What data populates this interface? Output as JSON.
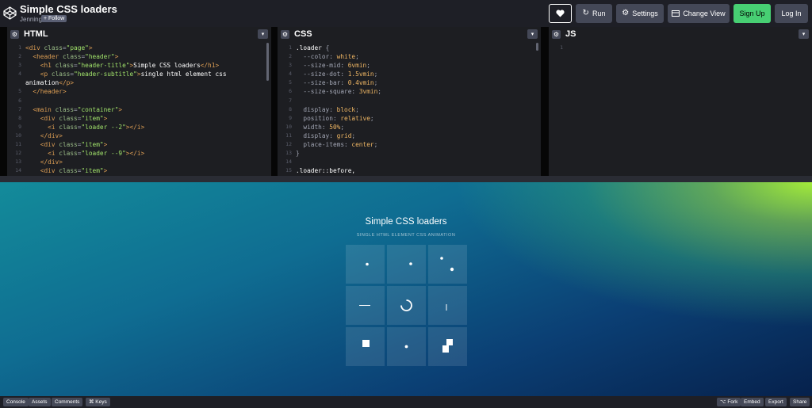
{
  "header": {
    "title": "Simple CSS loaders",
    "author": "Jenning",
    "follow_label": "+ Follow",
    "heart_icon": "heart-icon",
    "buttons": {
      "run": "Run",
      "settings": "Settings",
      "change_view": "Change View",
      "sign_up": "Sign Up",
      "log_in": "Log In"
    },
    "accent_color": "#47cf73"
  },
  "editors": {
    "html": {
      "label": "HTML",
      "line_numbers": [
        "1",
        "2",
        "3",
        "4",
        "",
        "5",
        "6",
        "7",
        "8",
        "9",
        "10",
        "11",
        "12",
        "13",
        "14"
      ],
      "lines": [
        [
          [
            "t",
            "<div "
          ],
          [
            "a",
            "class"
          ],
          [
            "p",
            "="
          ],
          [
            "s",
            "\"page\""
          ],
          [
            "t",
            ">"
          ]
        ],
        [
          [
            "h",
            "  "
          ],
          [
            "t",
            "<header "
          ],
          [
            "a",
            "class"
          ],
          [
            "p",
            "="
          ],
          [
            "s",
            "\"header\""
          ],
          [
            "t",
            ">"
          ]
        ],
        [
          [
            "h",
            "    "
          ],
          [
            "t",
            "<h1 "
          ],
          [
            "a",
            "class"
          ],
          [
            "p",
            "="
          ],
          [
            "s",
            "\"header-title\""
          ],
          [
            "t",
            ">"
          ],
          [
            "h",
            "Simple CSS loaders"
          ],
          [
            "t",
            "</h1>"
          ]
        ],
        [
          [
            "h",
            "    "
          ],
          [
            "t",
            "<p "
          ],
          [
            "a",
            "class"
          ],
          [
            "p",
            "="
          ],
          [
            "s",
            "\"header-subtitle\""
          ],
          [
            "t",
            ">"
          ],
          [
            "h",
            "single html element css"
          ]
        ],
        [
          [
            "h",
            "animation"
          ],
          [
            "t",
            "</p>"
          ]
        ],
        [
          [
            "h",
            "  "
          ],
          [
            "t",
            "</header>"
          ]
        ],
        [
          [
            "h",
            ""
          ]
        ],
        [
          [
            "h",
            "  "
          ],
          [
            "t",
            "<main "
          ],
          [
            "a",
            "class"
          ],
          [
            "p",
            "="
          ],
          [
            "s",
            "\"container\""
          ],
          [
            "t",
            ">"
          ]
        ],
        [
          [
            "h",
            "    "
          ],
          [
            "t",
            "<div "
          ],
          [
            "a",
            "class"
          ],
          [
            "p",
            "="
          ],
          [
            "s",
            "\"item\""
          ],
          [
            "t",
            ">"
          ]
        ],
        [
          [
            "h",
            "      "
          ],
          [
            "t",
            "<i "
          ],
          [
            "a",
            "class"
          ],
          [
            "p",
            "="
          ],
          [
            "s",
            "\"loader --2\""
          ],
          [
            "t",
            ">"
          ],
          [
            "t",
            "</i>"
          ]
        ],
        [
          [
            "h",
            "    "
          ],
          [
            "t",
            "</div>"
          ]
        ],
        [
          [
            "h",
            "    "
          ],
          [
            "t",
            "<div "
          ],
          [
            "a",
            "class"
          ],
          [
            "p",
            "="
          ],
          [
            "s",
            "\"item\""
          ],
          [
            "t",
            ">"
          ]
        ],
        [
          [
            "h",
            "      "
          ],
          [
            "t",
            "<i "
          ],
          [
            "a",
            "class"
          ],
          [
            "p",
            "="
          ],
          [
            "s",
            "\"loader --9\""
          ],
          [
            "t",
            ">"
          ],
          [
            "t",
            "</i>"
          ]
        ],
        [
          [
            "h",
            "    "
          ],
          [
            "t",
            "</div>"
          ]
        ],
        [
          [
            "h",
            "    "
          ],
          [
            "t",
            "<div "
          ],
          [
            "a",
            "class"
          ],
          [
            "p",
            "="
          ],
          [
            "s",
            "\"item\""
          ],
          [
            "t",
            ">"
          ]
        ]
      ]
    },
    "css": {
      "label": "CSS",
      "line_numbers": [
        "1",
        "2",
        "3",
        "4",
        "5",
        "6",
        "7",
        "8",
        "9",
        "10",
        "11",
        "12",
        "13",
        "14",
        "15"
      ],
      "lines": [
        [
          [
            "h",
            ".loader "
          ],
          [
            "p",
            "{"
          ]
        ],
        [
          [
            "h",
            "  "
          ],
          [
            "p",
            "--color: "
          ],
          [
            "v",
            "white"
          ],
          [
            "p",
            ";"
          ]
        ],
        [
          [
            "h",
            "  "
          ],
          [
            "p",
            "--size-mid: "
          ],
          [
            "v",
            "6vmin"
          ],
          [
            "p",
            ";"
          ]
        ],
        [
          [
            "h",
            "  "
          ],
          [
            "p",
            "--size-dot: "
          ],
          [
            "v",
            "1.5vmin"
          ],
          [
            "p",
            ";"
          ]
        ],
        [
          [
            "h",
            "  "
          ],
          [
            "p",
            "--size-bar: "
          ],
          [
            "v",
            "0.4vmin"
          ],
          [
            "p",
            ";"
          ]
        ],
        [
          [
            "h",
            "  "
          ],
          [
            "p",
            "--size-square: "
          ],
          [
            "v",
            "3vmin"
          ],
          [
            "p",
            ";"
          ]
        ],
        [
          [
            "h",
            ""
          ]
        ],
        [
          [
            "h",
            "  "
          ],
          [
            "p",
            "display: "
          ],
          [
            "v",
            "block"
          ],
          [
            "p",
            ";"
          ]
        ],
        [
          [
            "h",
            "  "
          ],
          [
            "p",
            "position: "
          ],
          [
            "v",
            "relative"
          ],
          [
            "p",
            ";"
          ]
        ],
        [
          [
            "h",
            "  "
          ],
          [
            "p",
            "width: "
          ],
          [
            "v",
            "50%"
          ],
          [
            "p",
            ";"
          ]
        ],
        [
          [
            "h",
            "  "
          ],
          [
            "p",
            "display: "
          ],
          [
            "v",
            "grid"
          ],
          [
            "p",
            ";"
          ]
        ],
        [
          [
            "h",
            "  "
          ],
          [
            "p",
            "place-items: "
          ],
          [
            "v",
            "center"
          ],
          [
            "p",
            ";"
          ]
        ],
        [
          [
            "p",
            "}"
          ]
        ],
        [
          [
            "h",
            ""
          ]
        ],
        [
          [
            "h",
            ".loader::before,"
          ]
        ]
      ]
    },
    "js": {
      "label": "JS",
      "line_numbers": [
        "1"
      ],
      "lines": [
        [
          [
            "h",
            ""
          ]
        ]
      ]
    }
  },
  "preview": {
    "title": "Simple CSS loaders",
    "subtitle": "SINGLE HTML ELEMENT CSS ANIMATION",
    "loaders": [
      "dot",
      "dot",
      "two-dots",
      "bar",
      "spinner-arc",
      "vertical-bar",
      "square",
      "small-dot",
      "stacked-squares"
    ]
  },
  "footer": {
    "console": "Console",
    "assets": "Assets",
    "comments": "Comments",
    "keys": "⌘ Keys",
    "fork": "Fork",
    "embed": "Embed",
    "export": "Export",
    "share": "Share"
  }
}
